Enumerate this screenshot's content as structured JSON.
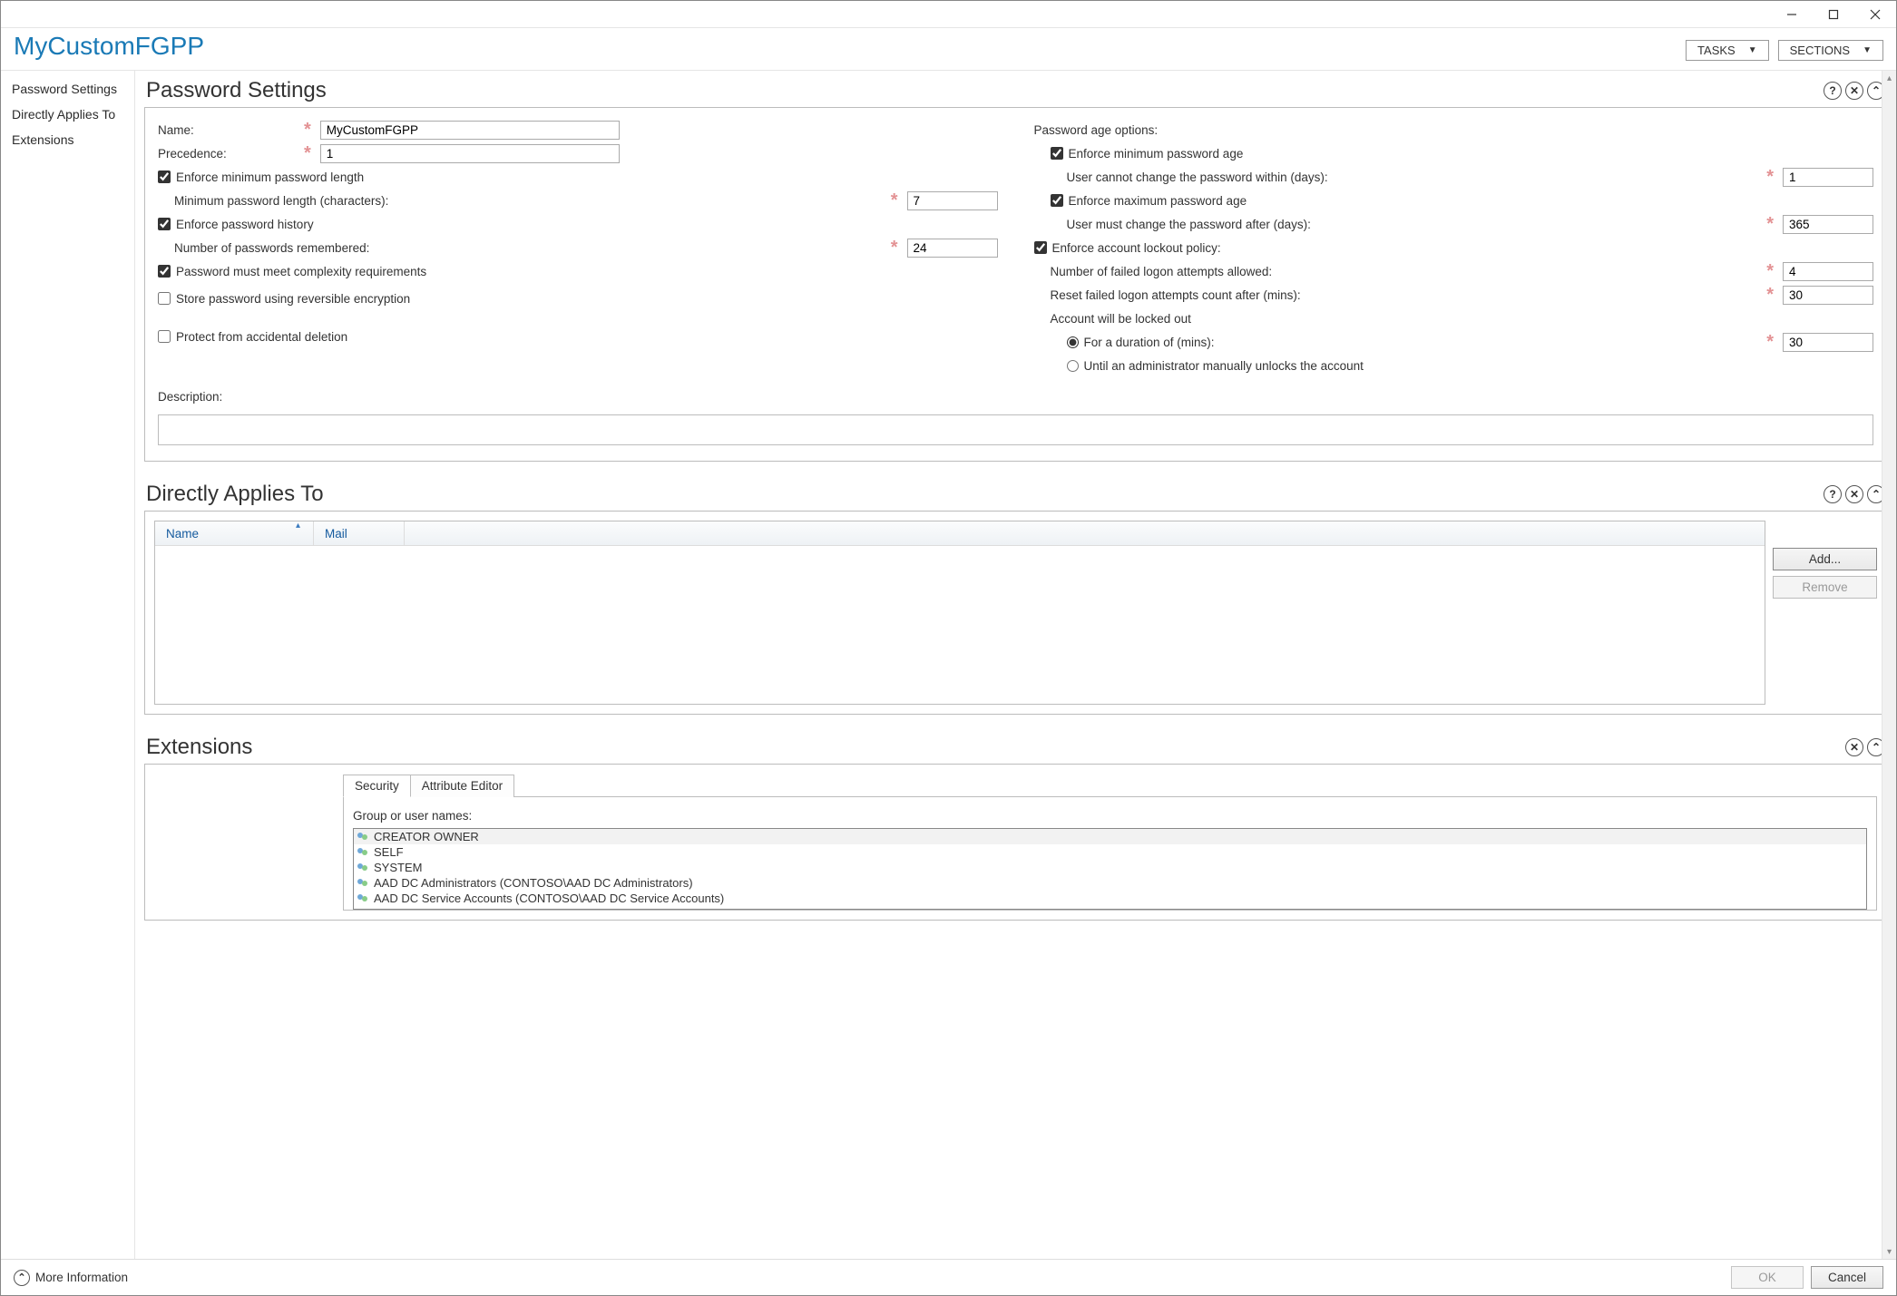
{
  "window": {
    "title": "MyCustomFGPP"
  },
  "header_buttons": {
    "tasks": "TASKS",
    "sections": "SECTIONS"
  },
  "nav": {
    "items": [
      "Password Settings",
      "Directly Applies To",
      "Extensions"
    ]
  },
  "sections": {
    "password": {
      "title": "Password Settings",
      "name_label": "Name:",
      "name_value": "MyCustomFGPP",
      "precedence_label": "Precedence:",
      "precedence_value": "1",
      "enforce_min_len": {
        "label": "Enforce minimum password length",
        "checked": true,
        "sub_label": "Minimum password length (characters):",
        "sub_value": "7"
      },
      "enforce_history": {
        "label": "Enforce password history",
        "checked": true,
        "sub_label": "Number of passwords remembered:",
        "sub_value": "24"
      },
      "complexity": {
        "label": "Password must meet complexity requirements",
        "checked": true
      },
      "reversible": {
        "label": "Store password using reversible encryption",
        "checked": false
      },
      "protect": {
        "label": "Protect from accidental deletion",
        "checked": false
      },
      "description_label": "Description:",
      "description_value": "",
      "age_header": "Password age options:",
      "min_age": {
        "label": "Enforce minimum password age",
        "checked": true,
        "sub_label": "User cannot change the password within (days):",
        "sub_value": "1"
      },
      "max_age": {
        "label": "Enforce maximum password age",
        "checked": true,
        "sub_label": "User must change the password after (days):",
        "sub_value": "365"
      },
      "lockout": {
        "label": "Enforce account lockout policy:",
        "checked": true,
        "attempts_label": "Number of failed logon attempts allowed:",
        "attempts_value": "4",
        "reset_label": "Reset failed logon attempts count after (mins):",
        "reset_value": "30",
        "lockedout_label": "Account will be locked out",
        "duration_option": "For a duration of (mins):",
        "duration_value": "30",
        "until_admin_option": "Until an administrator manually unlocks the account",
        "selected": "duration"
      }
    },
    "applies": {
      "title": "Directly Applies To",
      "columns": {
        "name": "Name",
        "mail": "Mail"
      },
      "rows": [],
      "add_btn": "Add...",
      "remove_btn": "Remove"
    },
    "extensions": {
      "title": "Extensions",
      "tabs": {
        "security": "Security",
        "attribute": "Attribute Editor"
      },
      "group_label": "Group or user names:",
      "groups": [
        "CREATOR OWNER",
        "SELF",
        "SYSTEM",
        "AAD DC Administrators (CONTOSO\\AAD DC Administrators)",
        "AAD DC Service Accounts (CONTOSO\\AAD DC Service Accounts)"
      ]
    }
  },
  "footer": {
    "more": "More Information",
    "ok": "OK",
    "cancel": "Cancel"
  }
}
